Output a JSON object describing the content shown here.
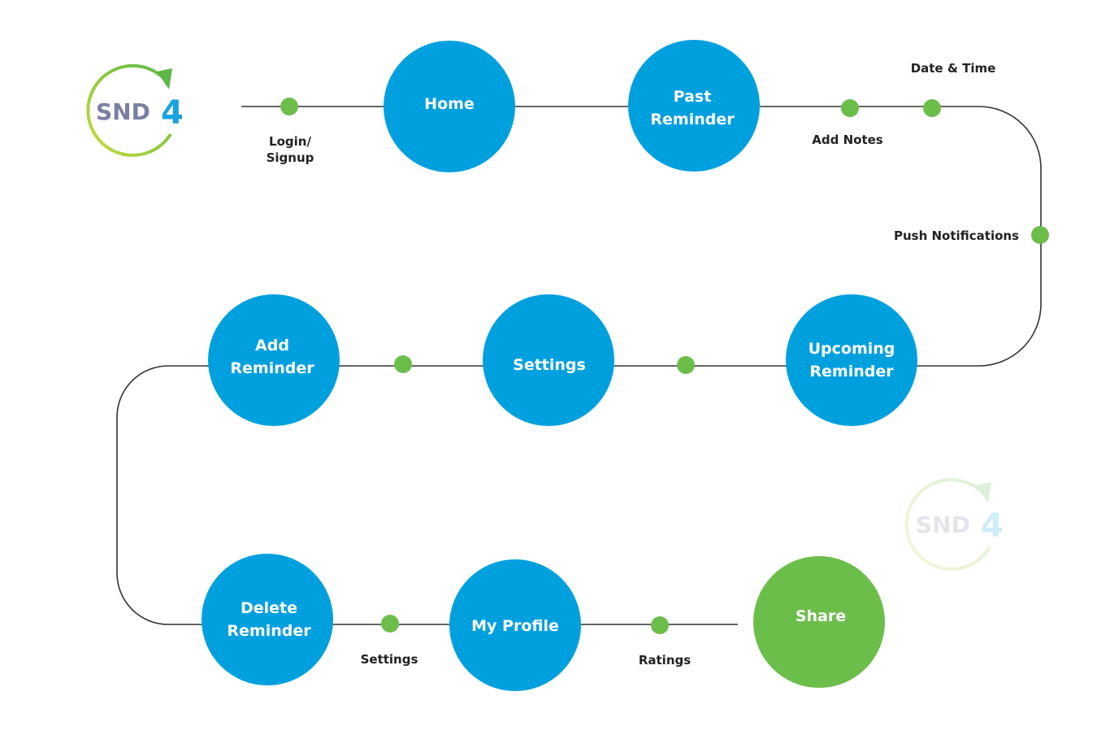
{
  "colors": {
    "node": "#00a0df",
    "share": "#6cbe4b",
    "dot": "#6cbe4b",
    "line": "#333333"
  },
  "logo": {
    "text": "SND4"
  },
  "nodes": {
    "home": [
      "Home"
    ],
    "past": [
      "Past",
      "Reminder"
    ],
    "upcoming": [
      "Upcoming",
      "Reminder"
    ],
    "settings": [
      "Settings"
    ],
    "add": [
      "Add",
      "Reminder"
    ],
    "delete": [
      "Delete",
      "Reminder"
    ],
    "profile": [
      "My Profile"
    ],
    "share": [
      "Share"
    ]
  },
  "labels": {
    "login": [
      "Login/",
      "Signup"
    ],
    "date_time": "Date & Time",
    "add_notes": "Add Notes",
    "push": "Push Notifications",
    "settings": "Settings",
    "ratings": "Ratings"
  }
}
